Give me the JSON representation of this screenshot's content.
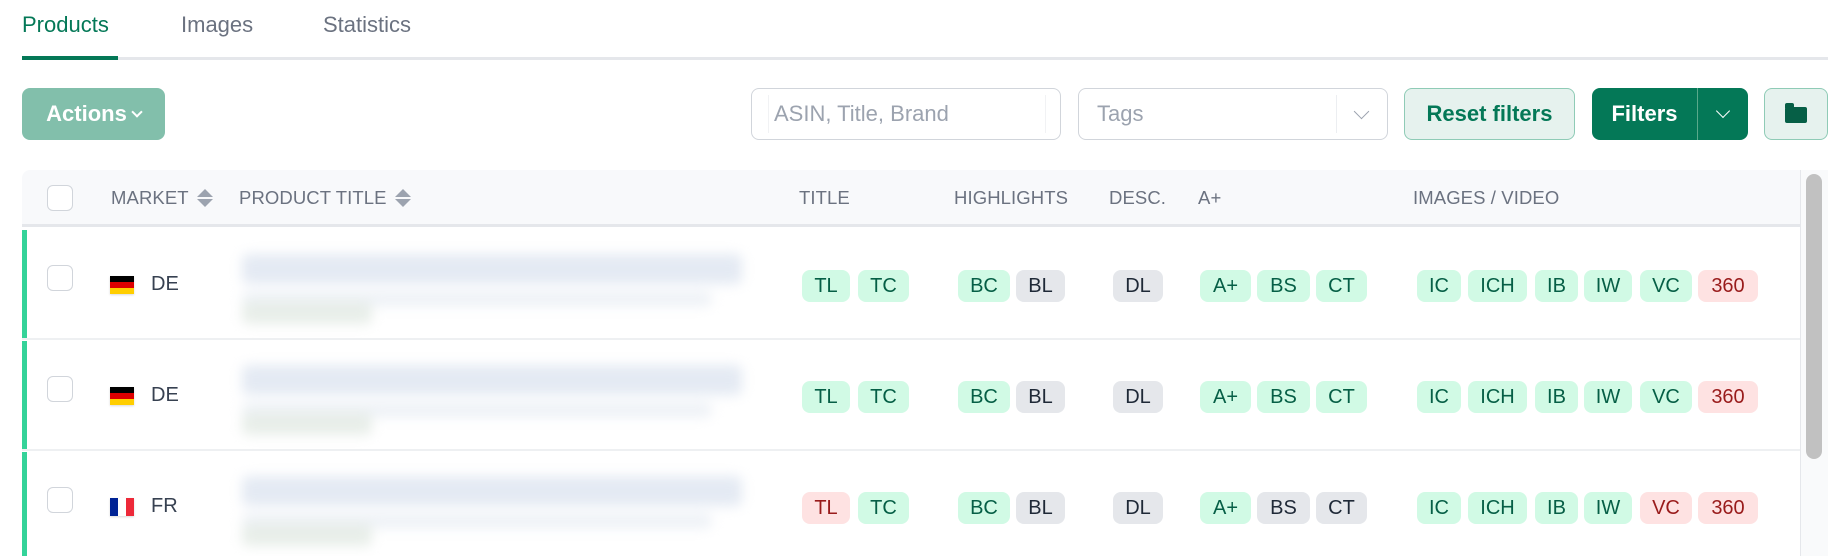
{
  "tabs": [
    {
      "label": "Products",
      "active": true
    },
    {
      "label": "Images",
      "active": false
    },
    {
      "label": "Statistics",
      "active": false
    }
  ],
  "toolbar": {
    "actions_label": "Actions",
    "search_placeholder": "ASIN, Title, Brand",
    "search_value": "",
    "tags_placeholder": "Tags",
    "reset_label": "Reset filters",
    "filters_label": "Filters",
    "folder_icon": "folder-icon"
  },
  "table": {
    "columns": {
      "market": "MARKET",
      "product_title": "PRODUCT TITLE",
      "title": "TITLE",
      "highlights": "HIGHLIGHTS",
      "desc": "DESC.",
      "aplus": "A+",
      "images_video": "IMAGES / VIDEO"
    },
    "rows": [
      {
        "market": "DE",
        "flag": "de",
        "product_title": "(blurred)",
        "title": [
          {
            "t": "TL",
            "s": "ok"
          },
          {
            "t": "TC",
            "s": "ok"
          }
        ],
        "highlights": [
          {
            "t": "BC",
            "s": "ok"
          },
          {
            "t": "BL",
            "s": "neutral"
          }
        ],
        "desc": [
          {
            "t": "DL",
            "s": "neutral"
          }
        ],
        "aplus": [
          {
            "t": "A+",
            "s": "ok"
          },
          {
            "t": "BS",
            "s": "ok"
          },
          {
            "t": "CT",
            "s": "ok"
          }
        ],
        "images": [
          {
            "t": "IC",
            "s": "ok"
          },
          {
            "t": "ICH",
            "s": "ok"
          },
          {
            "t": "IB",
            "s": "ok"
          },
          {
            "t": "IW",
            "s": "ok"
          },
          {
            "t": "VC",
            "s": "ok"
          },
          {
            "t": "360",
            "s": "bad"
          }
        ]
      },
      {
        "market": "DE",
        "flag": "de",
        "product_title": "(blurred)",
        "title": [
          {
            "t": "TL",
            "s": "ok"
          },
          {
            "t": "TC",
            "s": "ok"
          }
        ],
        "highlights": [
          {
            "t": "BC",
            "s": "ok"
          },
          {
            "t": "BL",
            "s": "neutral"
          }
        ],
        "desc": [
          {
            "t": "DL",
            "s": "neutral"
          }
        ],
        "aplus": [
          {
            "t": "A+",
            "s": "ok"
          },
          {
            "t": "BS",
            "s": "ok"
          },
          {
            "t": "CT",
            "s": "ok"
          }
        ],
        "images": [
          {
            "t": "IC",
            "s": "ok"
          },
          {
            "t": "ICH",
            "s": "ok"
          },
          {
            "t": "IB",
            "s": "ok"
          },
          {
            "t": "IW",
            "s": "ok"
          },
          {
            "t": "VC",
            "s": "ok"
          },
          {
            "t": "360",
            "s": "bad"
          }
        ]
      },
      {
        "market": "FR",
        "flag": "fr",
        "product_title": "(blurred)",
        "title": [
          {
            "t": "TL",
            "s": "bad"
          },
          {
            "t": "TC",
            "s": "ok"
          }
        ],
        "highlights": [
          {
            "t": "BC",
            "s": "ok"
          },
          {
            "t": "BL",
            "s": "neutral"
          }
        ],
        "desc": [
          {
            "t": "DL",
            "s": "neutral"
          }
        ],
        "aplus": [
          {
            "t": "A+",
            "s": "ok"
          },
          {
            "t": "BS",
            "s": "neutral"
          },
          {
            "t": "CT",
            "s": "neutral"
          }
        ],
        "images": [
          {
            "t": "IC",
            "s": "ok"
          },
          {
            "t": "ICH",
            "s": "ok"
          },
          {
            "t": "IB",
            "s": "ok"
          },
          {
            "t": "IW",
            "s": "ok"
          },
          {
            "t": "VC",
            "s": "bad"
          },
          {
            "t": "360",
            "s": "bad"
          }
        ]
      }
    ]
  },
  "colors": {
    "accent": "#047857",
    "ok_bg": "#d1fae5",
    "ok_text": "#065f46",
    "bad_bg": "#fee2e2",
    "bad_text": "#991b1b",
    "neutral_bg": "#e5e7eb",
    "row_indicator": "#34d399"
  }
}
